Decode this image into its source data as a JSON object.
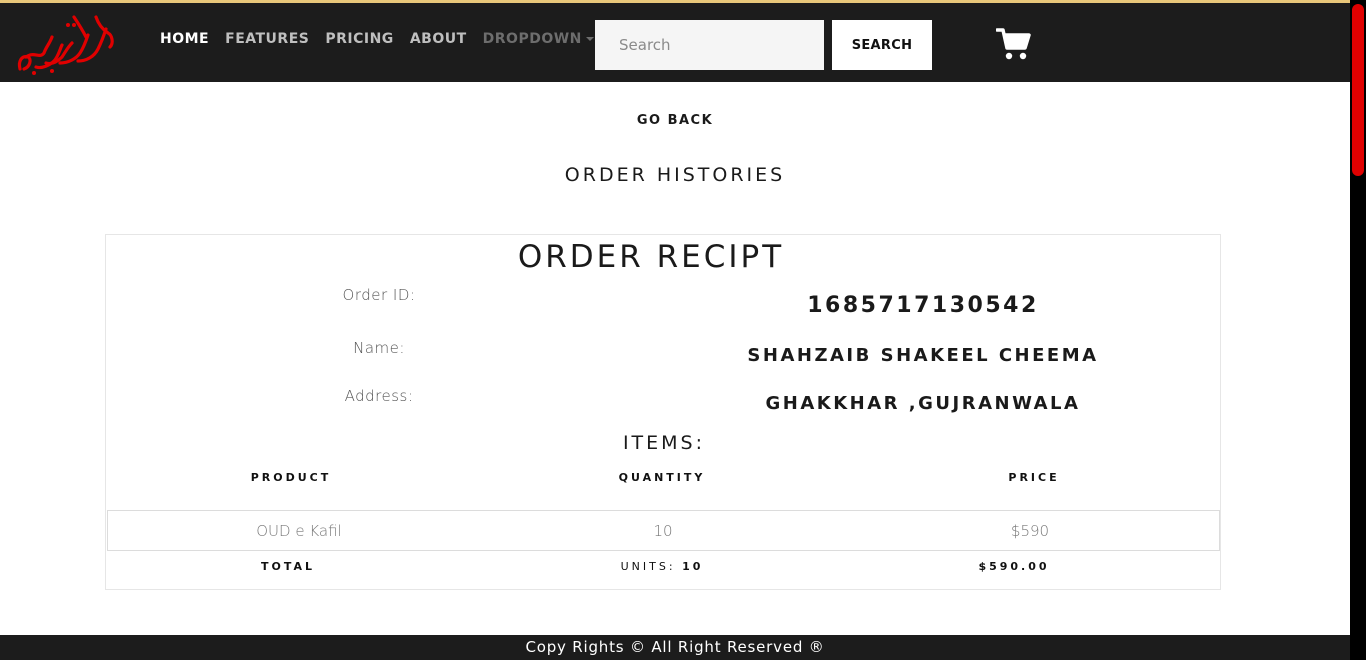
{
  "brand": {
    "logo_text": "مہکستان",
    "accent_color": "#e00000",
    "border_color": "#e8c77a"
  },
  "nav": {
    "items": [
      {
        "label": "HOME"
      },
      {
        "label": "FEATURES"
      },
      {
        "label": "PRICING"
      },
      {
        "label": "ABOUT"
      },
      {
        "label": "DROPDOWN"
      }
    ]
  },
  "search": {
    "placeholder": "Search",
    "button_label": "SEARCH"
  },
  "cart": {
    "icon": "cart-icon"
  },
  "page": {
    "go_back_label": "GO BACK",
    "title": "ORDER HISTORIES"
  },
  "receipt": {
    "title": "ORDER RECIPT",
    "order_id_label": "Order ID:",
    "order_id": "1685717130542",
    "name_label": "Name:",
    "name": "SHAHZAIB SHAKEEL CHEEMA",
    "address_label": "Address:",
    "address": "GHAKKHAR ,GUJRANWALA",
    "items_heading": "ITEMS:",
    "columns": {
      "product": "PRODUCT",
      "quantity": "QUANTITY",
      "price": "PRICE"
    },
    "items": [
      {
        "product": "OUD e Kafil",
        "quantity": "10",
        "price": "$590"
      }
    ],
    "total": {
      "label": "TOTAL",
      "units_label": "UNITS:",
      "units_value": "10",
      "amount": "$590.00"
    }
  },
  "footer": {
    "text": "Copy Rights © All Right Reserved ®"
  }
}
